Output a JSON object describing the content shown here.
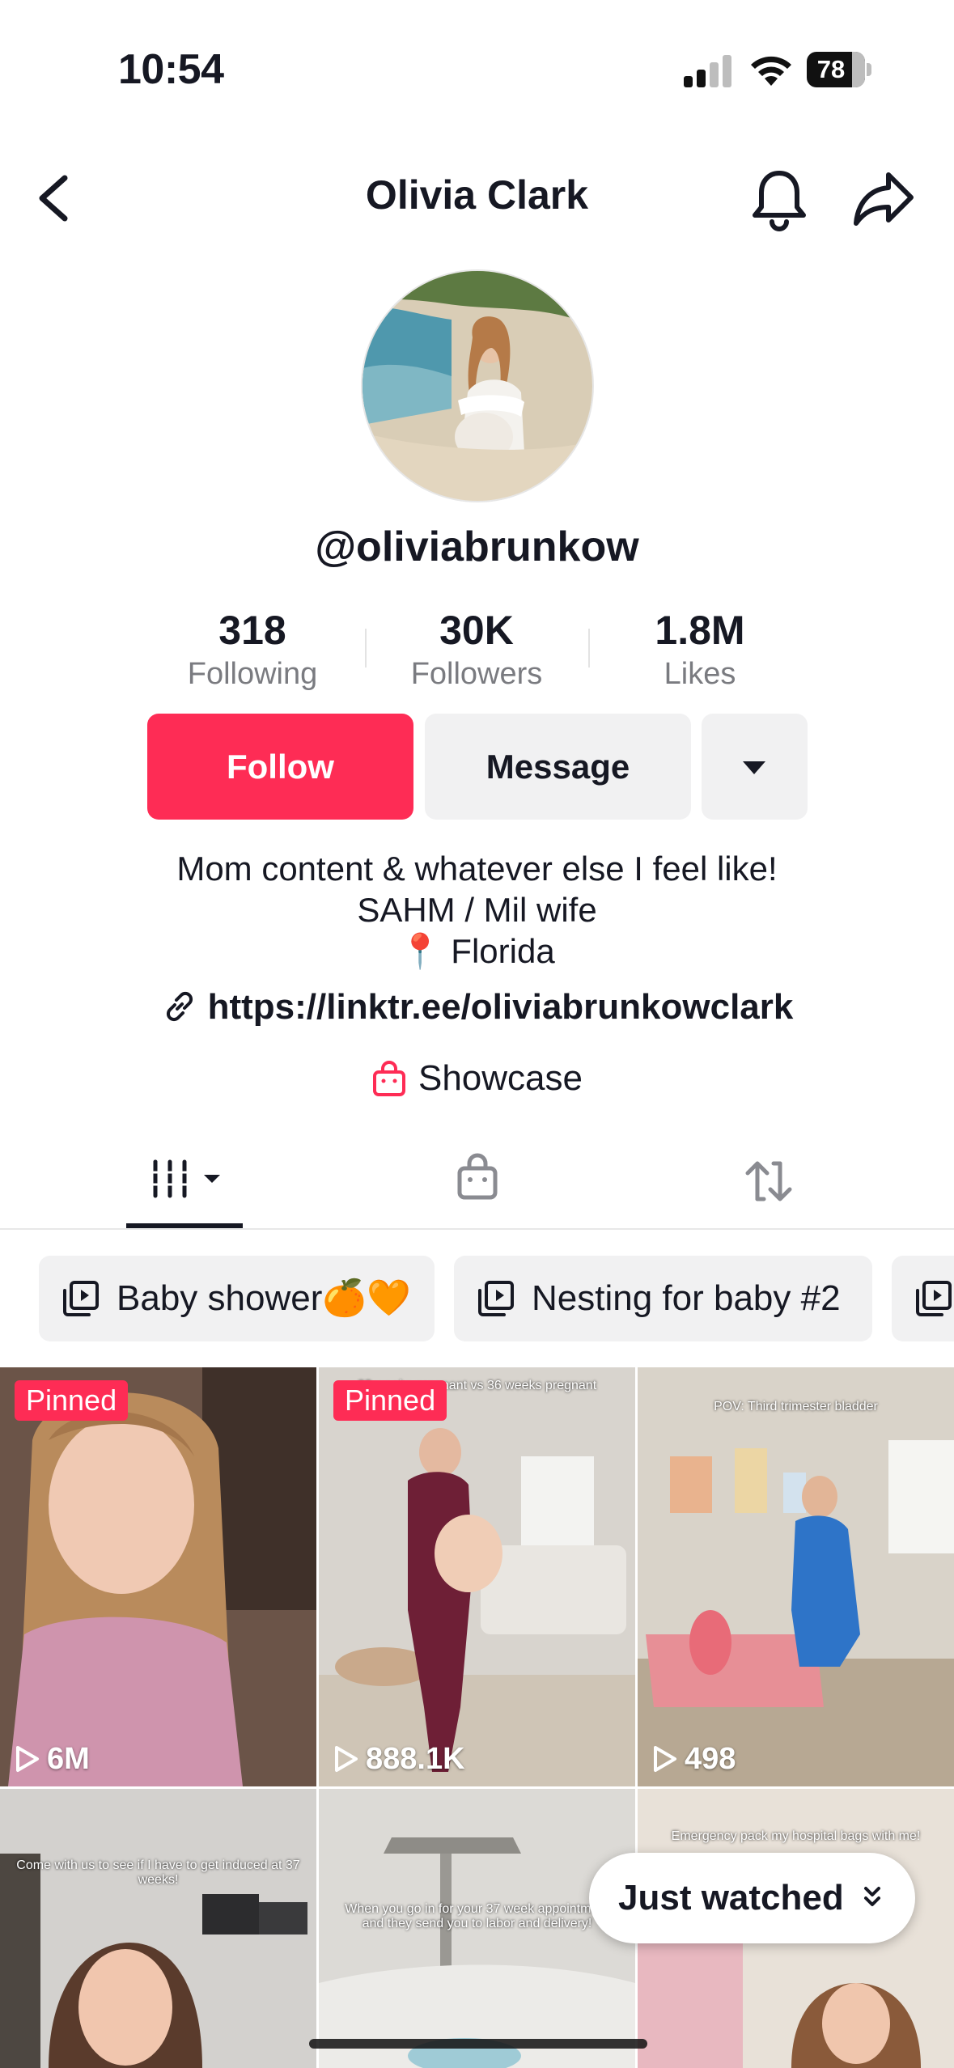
{
  "status_bar": {
    "time": "10:54",
    "battery": "78"
  },
  "header": {
    "title": "Olivia Clark"
  },
  "profile": {
    "username": "@oliviabrunkow",
    "stats": [
      {
        "value": "318",
        "label": "Following"
      },
      {
        "value": "30K",
        "label": "Followers"
      },
      {
        "value": "1.8M",
        "label": "Likes"
      }
    ],
    "follow_label": "Follow",
    "message_label": "Message",
    "bio": [
      "Mom content & whatever else I feel like!",
      "SAHM / Mil wife",
      "📍 Florida"
    ],
    "link": "https://linktr.ee/oliviabrunkowclark",
    "showcase_label": "Showcase"
  },
  "playlists": [
    {
      "label": "Baby shower🍊🧡"
    },
    {
      "label": "Nesting for baby #2"
    },
    {
      "label": ""
    }
  ],
  "videos": [
    {
      "pinned": "Pinned",
      "views": "6M",
      "caption": ""
    },
    {
      "pinned": "Pinned",
      "views": "888.1K",
      "caption": "33 weeks pregnant vs 36 weeks pregnant"
    },
    {
      "pinned": "",
      "views": "498",
      "caption": "POV: Third trimester bladder"
    },
    {
      "pinned": "",
      "views": "",
      "caption": "Come with us to see if I have to get induced at 37 weeks!"
    },
    {
      "pinned": "",
      "views": "",
      "caption": "When you go in for your 37 week appointment and they send you to labor and delivery!"
    },
    {
      "pinned": "",
      "views": "",
      "caption": "Emergency pack my hospital bags with me!"
    }
  ],
  "just_watched_label": "Just watched",
  "colors": {
    "accent": "#fe2c55",
    "button_gray": "#f1f1f2",
    "text": "#161823",
    "muted": "#7a7b80"
  }
}
